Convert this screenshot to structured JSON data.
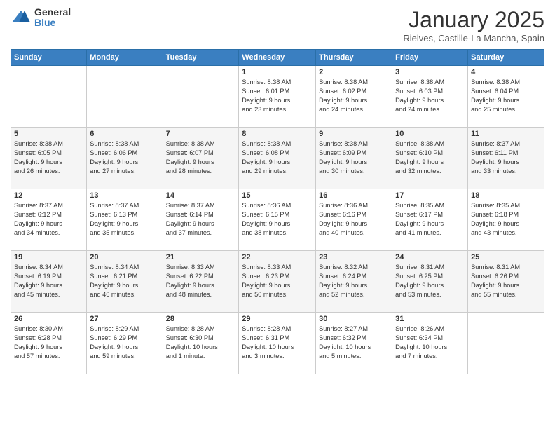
{
  "logo": {
    "general": "General",
    "blue": "Blue"
  },
  "header": {
    "month": "January 2025",
    "location": "Rielves, Castille-La Mancha, Spain"
  },
  "weekdays": [
    "Sunday",
    "Monday",
    "Tuesday",
    "Wednesday",
    "Thursday",
    "Friday",
    "Saturday"
  ],
  "weeks": [
    [
      {
        "day": "",
        "info": ""
      },
      {
        "day": "",
        "info": ""
      },
      {
        "day": "",
        "info": ""
      },
      {
        "day": "1",
        "info": "Sunrise: 8:38 AM\nSunset: 6:01 PM\nDaylight: 9 hours\nand 23 minutes."
      },
      {
        "day": "2",
        "info": "Sunrise: 8:38 AM\nSunset: 6:02 PM\nDaylight: 9 hours\nand 24 minutes."
      },
      {
        "day": "3",
        "info": "Sunrise: 8:38 AM\nSunset: 6:03 PM\nDaylight: 9 hours\nand 24 minutes."
      },
      {
        "day": "4",
        "info": "Sunrise: 8:38 AM\nSunset: 6:04 PM\nDaylight: 9 hours\nand 25 minutes."
      }
    ],
    [
      {
        "day": "5",
        "info": "Sunrise: 8:38 AM\nSunset: 6:05 PM\nDaylight: 9 hours\nand 26 minutes."
      },
      {
        "day": "6",
        "info": "Sunrise: 8:38 AM\nSunset: 6:06 PM\nDaylight: 9 hours\nand 27 minutes."
      },
      {
        "day": "7",
        "info": "Sunrise: 8:38 AM\nSunset: 6:07 PM\nDaylight: 9 hours\nand 28 minutes."
      },
      {
        "day": "8",
        "info": "Sunrise: 8:38 AM\nSunset: 6:08 PM\nDaylight: 9 hours\nand 29 minutes."
      },
      {
        "day": "9",
        "info": "Sunrise: 8:38 AM\nSunset: 6:09 PM\nDaylight: 9 hours\nand 30 minutes."
      },
      {
        "day": "10",
        "info": "Sunrise: 8:38 AM\nSunset: 6:10 PM\nDaylight: 9 hours\nand 32 minutes."
      },
      {
        "day": "11",
        "info": "Sunrise: 8:37 AM\nSunset: 6:11 PM\nDaylight: 9 hours\nand 33 minutes."
      }
    ],
    [
      {
        "day": "12",
        "info": "Sunrise: 8:37 AM\nSunset: 6:12 PM\nDaylight: 9 hours\nand 34 minutes."
      },
      {
        "day": "13",
        "info": "Sunrise: 8:37 AM\nSunset: 6:13 PM\nDaylight: 9 hours\nand 35 minutes."
      },
      {
        "day": "14",
        "info": "Sunrise: 8:37 AM\nSunset: 6:14 PM\nDaylight: 9 hours\nand 37 minutes."
      },
      {
        "day": "15",
        "info": "Sunrise: 8:36 AM\nSunset: 6:15 PM\nDaylight: 9 hours\nand 38 minutes."
      },
      {
        "day": "16",
        "info": "Sunrise: 8:36 AM\nSunset: 6:16 PM\nDaylight: 9 hours\nand 40 minutes."
      },
      {
        "day": "17",
        "info": "Sunrise: 8:35 AM\nSunset: 6:17 PM\nDaylight: 9 hours\nand 41 minutes."
      },
      {
        "day": "18",
        "info": "Sunrise: 8:35 AM\nSunset: 6:18 PM\nDaylight: 9 hours\nand 43 minutes."
      }
    ],
    [
      {
        "day": "19",
        "info": "Sunrise: 8:34 AM\nSunset: 6:19 PM\nDaylight: 9 hours\nand 45 minutes."
      },
      {
        "day": "20",
        "info": "Sunrise: 8:34 AM\nSunset: 6:21 PM\nDaylight: 9 hours\nand 46 minutes."
      },
      {
        "day": "21",
        "info": "Sunrise: 8:33 AM\nSunset: 6:22 PM\nDaylight: 9 hours\nand 48 minutes."
      },
      {
        "day": "22",
        "info": "Sunrise: 8:33 AM\nSunset: 6:23 PM\nDaylight: 9 hours\nand 50 minutes."
      },
      {
        "day": "23",
        "info": "Sunrise: 8:32 AM\nSunset: 6:24 PM\nDaylight: 9 hours\nand 52 minutes."
      },
      {
        "day": "24",
        "info": "Sunrise: 8:31 AM\nSunset: 6:25 PM\nDaylight: 9 hours\nand 53 minutes."
      },
      {
        "day": "25",
        "info": "Sunrise: 8:31 AM\nSunset: 6:26 PM\nDaylight: 9 hours\nand 55 minutes."
      }
    ],
    [
      {
        "day": "26",
        "info": "Sunrise: 8:30 AM\nSunset: 6:28 PM\nDaylight: 9 hours\nand 57 minutes."
      },
      {
        "day": "27",
        "info": "Sunrise: 8:29 AM\nSunset: 6:29 PM\nDaylight: 9 hours\nand 59 minutes."
      },
      {
        "day": "28",
        "info": "Sunrise: 8:28 AM\nSunset: 6:30 PM\nDaylight: 10 hours\nand 1 minute."
      },
      {
        "day": "29",
        "info": "Sunrise: 8:28 AM\nSunset: 6:31 PM\nDaylight: 10 hours\nand 3 minutes."
      },
      {
        "day": "30",
        "info": "Sunrise: 8:27 AM\nSunset: 6:32 PM\nDaylight: 10 hours\nand 5 minutes."
      },
      {
        "day": "31",
        "info": "Sunrise: 8:26 AM\nSunset: 6:34 PM\nDaylight: 10 hours\nand 7 minutes."
      },
      {
        "day": "",
        "info": ""
      }
    ]
  ]
}
